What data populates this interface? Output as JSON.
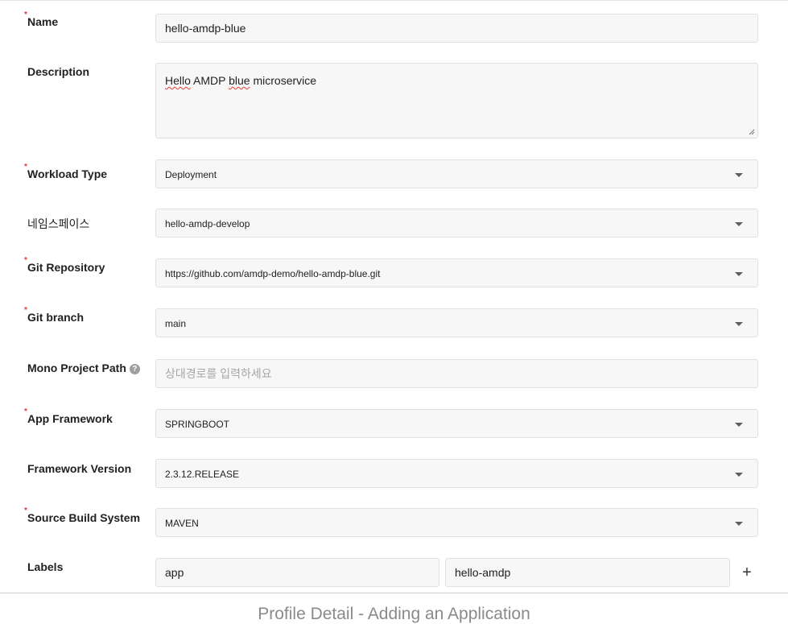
{
  "form": {
    "name": {
      "label": "Name",
      "required": "*",
      "value": "hello-amdp-blue"
    },
    "description": {
      "label": "Description",
      "value": "Hello AMDP blue microservice",
      "words": [
        "Hello",
        "AMDP",
        "blue",
        "microservice"
      ]
    },
    "workload_type": {
      "label": "Workload Type",
      "required": "*",
      "value": "Deployment"
    },
    "namespace": {
      "label": "네임스페이스",
      "value": "hello-amdp-develop"
    },
    "git_repository": {
      "label": "Git Repository",
      "required": "*",
      "value": "https://github.com/amdp-demo/hello-amdp-blue.git"
    },
    "git_branch": {
      "label": "Git branch",
      "required": "*",
      "value": "main"
    },
    "mono_project_path": {
      "label": "Mono Project Path",
      "help": "?",
      "placeholder": "상대경로를 입력하세요"
    },
    "app_framework": {
      "label": "App Framework",
      "required": "*",
      "value": "SPRINGBOOT"
    },
    "framework_version": {
      "label": "Framework Version",
      "value": "2.3.12.RELEASE"
    },
    "source_build_system": {
      "label": "Source Build System",
      "required": "*",
      "value": "MAVEN"
    },
    "labels": {
      "label": "Labels",
      "key": "app",
      "value": "hello-amdp",
      "add": "+"
    }
  },
  "caption": "Profile Detail - Adding an Application",
  "colors": {
    "required": "#e53935",
    "field_bg": "#f7f7f7",
    "field_border": "#e1e1e1",
    "caption": "#8a8a8a"
  }
}
